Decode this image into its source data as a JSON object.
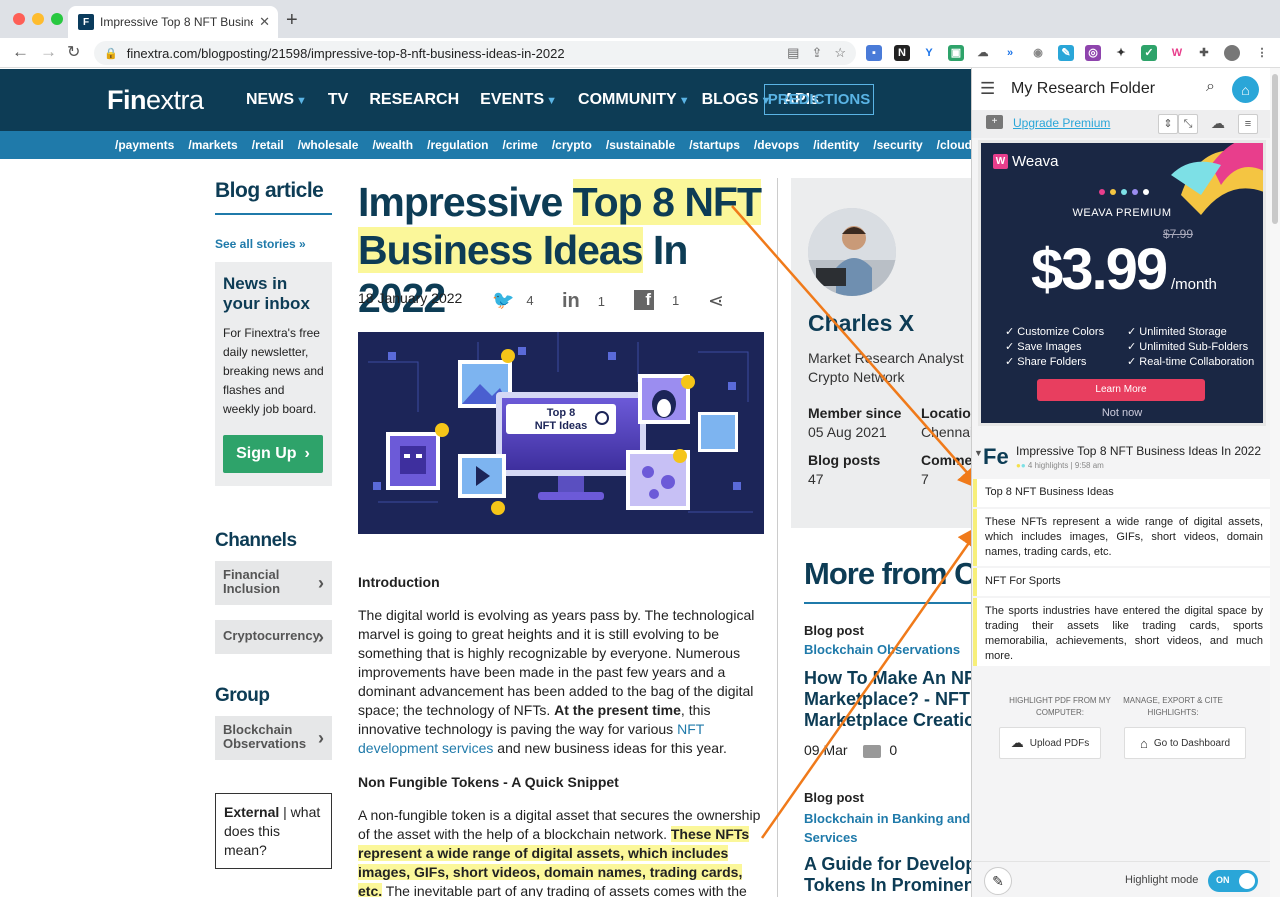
{
  "browser": {
    "tab_title": "Impressive Top 8 NFT Business Ideas In 2022",
    "url": "finextra.com/blogposting/21598/impressive-top-8-nft-business-ideas-in-2022"
  },
  "site": {
    "logo_fin": "Fin",
    "logo_extra": "extra",
    "nav": [
      "NEWS",
      "TV",
      "RESEARCH",
      "EVENTS",
      "COMMUNITY",
      "BLOGS",
      "APIs"
    ],
    "predictions": "PREDICTIONS",
    "subnav": [
      "/payments",
      "/markets",
      "/retail",
      "/wholesale",
      "/wealth",
      "/regulation",
      "/crime",
      "/crypto",
      "/sustainable",
      "/startups",
      "/devops",
      "/identity",
      "/security",
      "/cloud"
    ]
  },
  "sidebar": {
    "blog_article": "Blog article",
    "see_all": "See all stories »",
    "inbox_title": "News in your inbox",
    "inbox_text": "For Finextra's free daily newsletter, breaking news and flashes and weekly job board.",
    "signup": "Sign Up",
    "channels": "Channels",
    "channel_items": [
      "Financial Inclusion",
      "Cryptocurrency"
    ],
    "group": "Group",
    "group_items": [
      "Blockchain Observations"
    ],
    "external_bold": "External",
    "external_rest": " | what does this mean?"
  },
  "article": {
    "title_hl1": "Top 8 NFT",
    "title_plain1": "Impressive ",
    "title_hl2": "Business Ideas",
    "title_plain2": " In 2022",
    "date": "18 January 2022",
    "share": [
      {
        "icon": "twitter-icon",
        "glyph": "🐦",
        "count": "4"
      },
      {
        "icon": "linkedin-icon",
        "glyph": "in",
        "count": "1"
      },
      {
        "icon": "facebook-icon",
        "glyph": "f",
        "count": "1"
      }
    ],
    "hero_label": "Top 8 NFT Ideas",
    "intro_h": "Introduction",
    "p1a": "The digital world is evolving as years pass by. The technological marvel is going to great heights and it is still evolving to be something that is highly recognizable by everyone. Numerous improvements have been made in the past few years and a dominant advancement has been added to the bag of the digital space; the technology of NFTs. ",
    "p1b": "At the present time",
    "p1c": ", this innovative technology is paving the way for various ",
    "p1link": "NFT development services",
    "p1d": " and new business ideas for this year.",
    "h2": "Non Fungible Tokens - A Quick Snippet",
    "p2a": "A non-fungible token is a digital asset that secures the ownership of the asset with the help of a blockchain network. ",
    "p2hl": "These NFTs represent a wide range of digital assets, which includes images, GIFs, short videos, domain names, trading cards, etc.",
    "p2b": " The inevitable part of any trading of assets comes with the ability to"
  },
  "author": {
    "name": "Charles X",
    "role": "Market Research Analyst",
    "org": "Crypto Network",
    "member_label": "Member since",
    "member_value": "05 Aug 2021",
    "location_label": "Location",
    "location_value": "Chennai",
    "posts_label": "Blog posts",
    "posts_value": "47",
    "comments_label": "Comments",
    "comments_value": "7"
  },
  "more": {
    "heading": "More from Charles",
    "items": [
      {
        "label": "Blog post",
        "category": "Blockchain Observations",
        "title1": "How To Make An NFT",
        "title2": "Marketplace? - NFT",
        "title3": "Marketplace Creation",
        "date": "09 Mar",
        "comments": "0"
      },
      {
        "label": "Blog post",
        "category": "Blockchain in Banking and Financial",
        "category2": "Services",
        "title1": "A Guide for Developing",
        "title2": "Tokens In Prominent"
      }
    ]
  },
  "panel": {
    "title": "My Research Folder",
    "upgrade": "Upgrade Premium",
    "ad": {
      "brand": "Weava",
      "premium": "WEAVA PREMIUM",
      "old_price": "$7.99",
      "price": "$3.99",
      "per": "/month",
      "features_left": [
        "Customize Colors",
        "Save Images",
        "Share Folders"
      ],
      "features_right": [
        "Unlimited Storage",
        "Unlimited Sub-Folders",
        "Real-time Collaboration"
      ],
      "learn_more": "Learn More",
      "not_now": "Not now"
    },
    "doc_title": "Impressive Top 8 NFT Business Ideas In 2022",
    "doc_meta": "4 highlights | 9:58 am",
    "highlights": [
      "Top 8 NFT Business Ideas",
      "These NFTs represent a wide range of digital assets, which includes images, GIFs, short videos, domain names, trading cards, etc.",
      "NFT For Sports",
      "The sports industries have entered the digital space by trading their assets like trading cards, sports memorabilia, achievements, short videos, and much more."
    ],
    "highlight_pdf_label": "HIGHLIGHT PDF FROM MY COMPUTER:",
    "manage_label": "MANAGE, EXPORT & CITE HIGHLIGHTS:",
    "upload_pdfs": "Upload PDFs",
    "dashboard": "Go to Dashboard",
    "highlight_mode": "Highlight mode",
    "toggle": "ON"
  },
  "colors": {
    "brand_navy": "#0d3c55",
    "brand_blue": "#1f7aaa",
    "highlight_yellow": "#fbf79a",
    "arrow_orange": "#f07a1a",
    "weava_blue": "#2aa6d8"
  }
}
